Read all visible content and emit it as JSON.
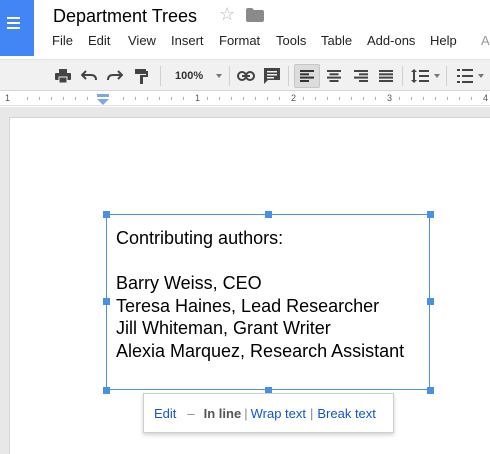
{
  "header": {
    "doc_title": "Department Trees",
    "star_icon": "star-outline-icon",
    "folder_icon": "folder-icon",
    "app_icon": "docs-app-icon"
  },
  "menubar": {
    "items": [
      "File",
      "Edit",
      "View",
      "Insert",
      "Format",
      "Tools",
      "Table",
      "Add-ons",
      "Help"
    ],
    "overflow_label": "A"
  },
  "toolbar": {
    "zoom": "100%",
    "buttons": [
      "print-icon",
      "undo-icon",
      "redo-icon",
      "paint-format-icon",
      "link-icon",
      "comment-icon",
      "align-left-icon",
      "align-center-icon",
      "align-right-icon",
      "align-justify-icon",
      "line-spacing-icon",
      "numbered-list-icon"
    ],
    "active_alignment": "align-left"
  },
  "ruler": {
    "numbers": [
      "1",
      "1",
      "2",
      "3",
      "4"
    ]
  },
  "drawing": {
    "lines": [
      "Contributing authors:",
      "",
      "Barry Weiss, CEO",
      "Teresa Haines, Lead Researcher",
      "Jill Whiteman, Grant Writer",
      "Alexia Marquez, Research Assistant"
    ]
  },
  "popup": {
    "edit": "Edit",
    "dash": "–",
    "inline": "In line",
    "separator": "|",
    "wrap": "Wrap text",
    "break": "Break text"
  },
  "colors": {
    "brand": "#4285f4",
    "selection": "#4a90e2",
    "link": "#1155cc"
  }
}
